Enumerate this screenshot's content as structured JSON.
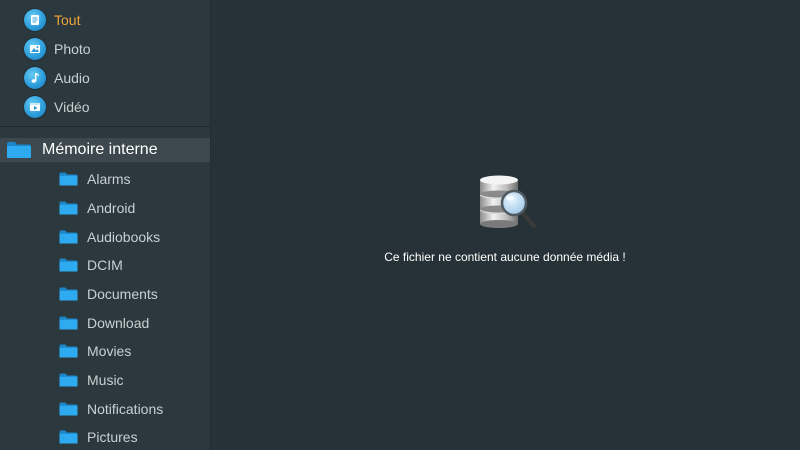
{
  "categories": [
    {
      "label": "Tout",
      "icon": "document-icon",
      "active": true
    },
    {
      "label": "Photo",
      "icon": "image-icon",
      "active": false
    },
    {
      "label": "Audio",
      "icon": "music-note-icon",
      "active": false
    },
    {
      "label": "Vidéo",
      "icon": "video-icon",
      "active": false
    }
  ],
  "storage": {
    "root_label": "Mémoire interne",
    "folders": [
      "Alarms",
      "Android",
      "Audiobooks",
      "DCIM",
      "Documents",
      "Download",
      "Movies",
      "Music",
      "Notifications",
      "Pictures"
    ]
  },
  "main": {
    "empty_message": "Ce fichier ne contient aucune donnée média !",
    "empty_icon": "database-search-icon"
  },
  "colors": {
    "background": "#263237",
    "sidebar": "#2b383d",
    "active_text": "#f0a23a",
    "folder_blue": "#29a8e8"
  }
}
